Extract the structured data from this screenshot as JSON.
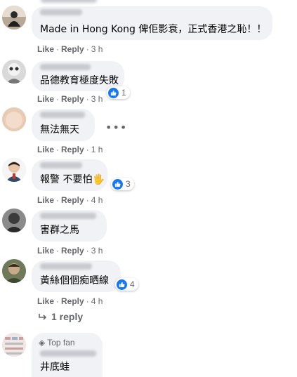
{
  "top_actions": {
    "like": "Like",
    "reply": "Reply"
  },
  "comments": [
    {
      "text": "Made in Hong Kong 俾佢影衰，正式香港之恥！！",
      "like": "Like",
      "reply": "Reply",
      "time": "3 h"
    },
    {
      "text": "品德教育極度失敗",
      "like": "Like",
      "reply": "Reply",
      "time": "3 h",
      "reactions": "1"
    },
    {
      "text": "無法無天",
      "like": "Like",
      "reply": "Reply",
      "time": "1 h",
      "more": "•••"
    },
    {
      "text": "報警 不要怕🖐",
      "like": "Like",
      "reply": "Reply",
      "time": "4 h",
      "reactions": "3"
    },
    {
      "text": "害群之馬",
      "like": "Like",
      "reply": "Reply",
      "time": "3 h"
    },
    {
      "text": "黃絲個個痴晒線",
      "like": "Like",
      "reply": "Reply",
      "time": "4 h",
      "reactions": "4"
    },
    {
      "text": "井底蛙",
      "badge": "Top fan"
    }
  ],
  "replies_link": "1 reply",
  "colors": {
    "accent": "#1877f2",
    "bubble": "#f0f2f5",
    "meta": "#65676b"
  },
  "icons": {
    "reaction": "like-thumb-icon",
    "reply": "reply-arrow-icon",
    "badge": "diamond-icon",
    "more": "more-dots-icon"
  }
}
